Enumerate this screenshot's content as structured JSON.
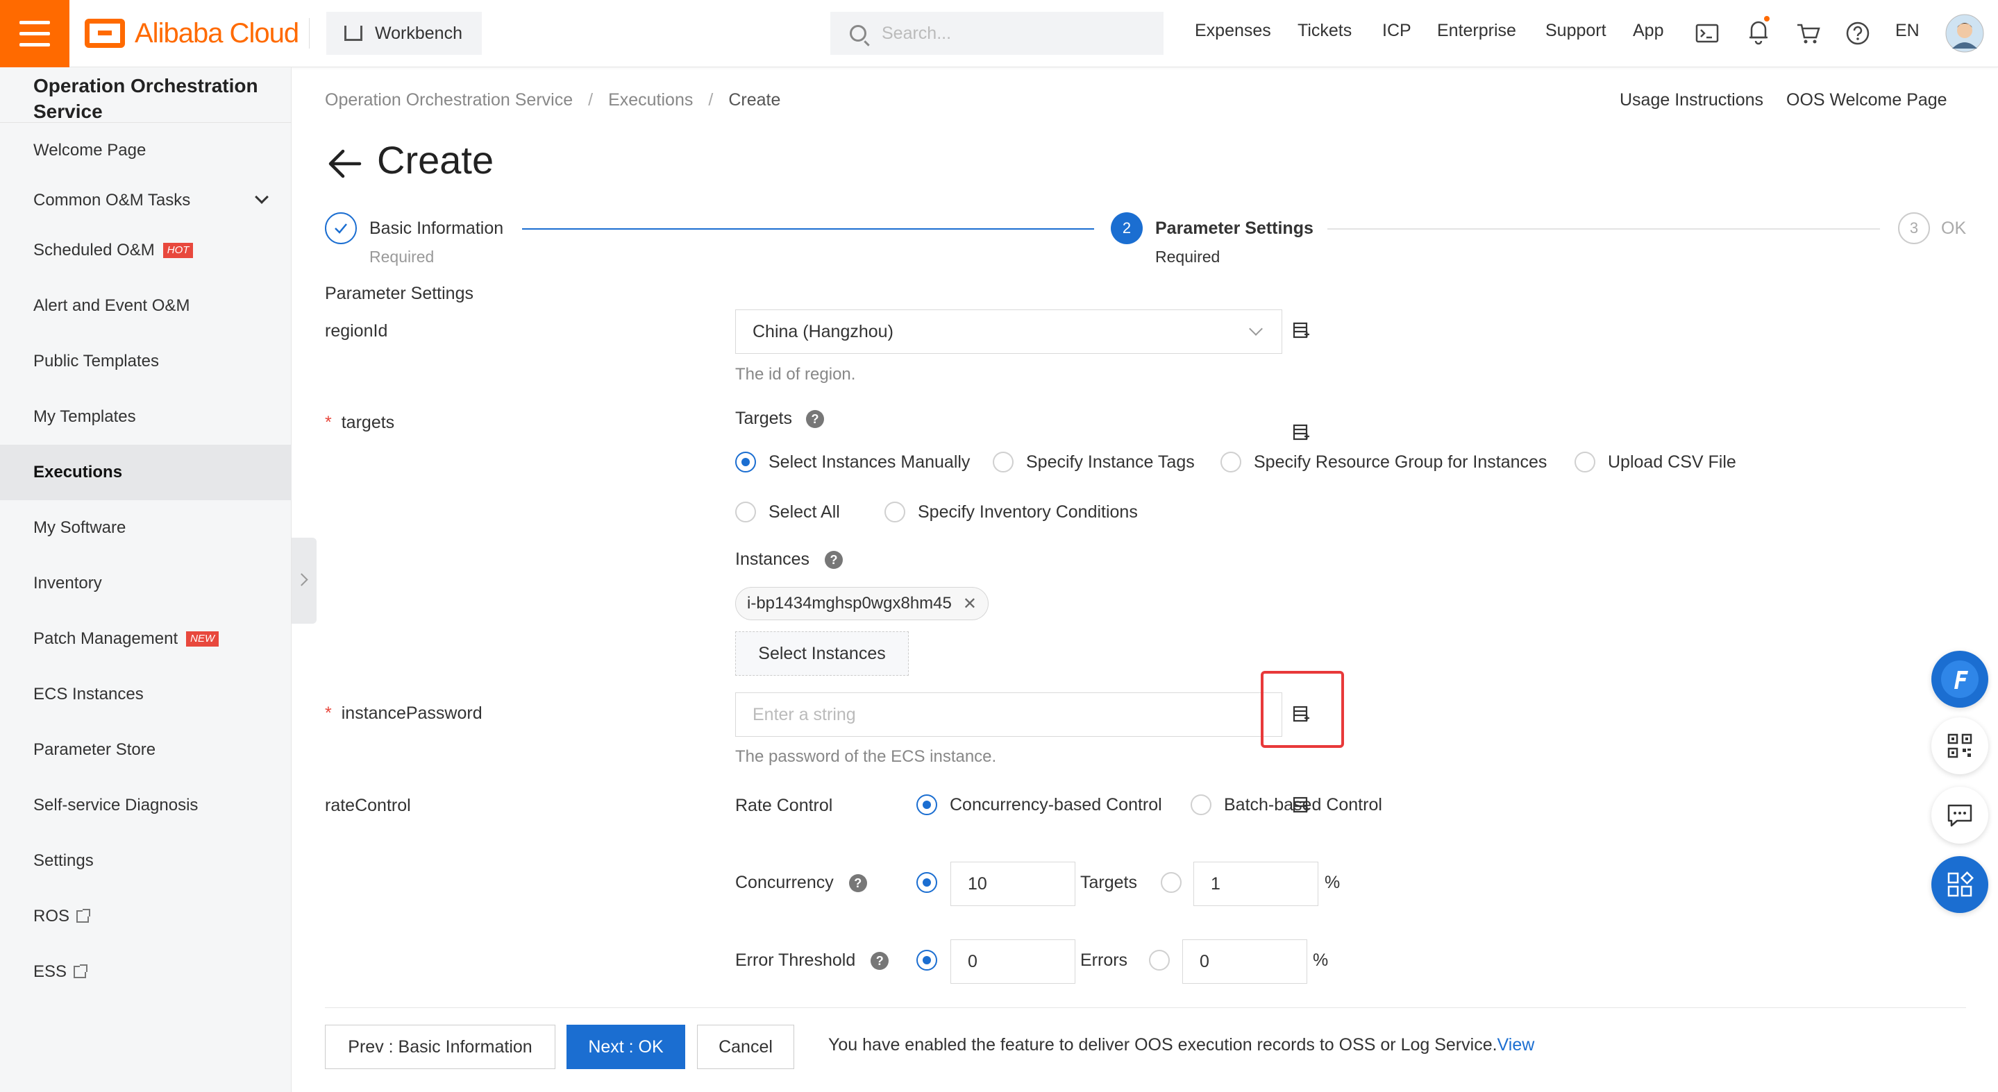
{
  "topbar": {
    "brand": "Alibaba Cloud",
    "workbench": "Workbench",
    "search_placeholder": "Search...",
    "nav": [
      "Expenses",
      "Tickets",
      "ICP",
      "Enterprise",
      "Support",
      "App"
    ],
    "language": "EN"
  },
  "sidebar": {
    "title": "Operation Orchestration Service",
    "items": [
      {
        "label": "Welcome Page"
      },
      {
        "label": "Common O&M Tasks"
      },
      {
        "label": "Scheduled O&M",
        "tag": "HOT"
      },
      {
        "label": "Alert and Event O&M"
      },
      {
        "label": "Public Templates"
      },
      {
        "label": "My Templates"
      },
      {
        "label": "Executions"
      },
      {
        "label": "My Software"
      },
      {
        "label": "Inventory"
      },
      {
        "label": "Patch Management",
        "tag": "NEW"
      },
      {
        "label": "ECS Instances"
      },
      {
        "label": "Parameter Store"
      },
      {
        "label": "Self-service Diagnosis"
      },
      {
        "label": "Settings"
      },
      {
        "label": "ROS"
      },
      {
        "label": "ESS"
      }
    ]
  },
  "breadcrumb": [
    "Operation Orchestration Service",
    "Executions",
    "Create"
  ],
  "header_links": {
    "usage": "Usage Instructions",
    "welcome": "OOS Welcome Page"
  },
  "page_title": "Create",
  "steps": [
    {
      "title": "Basic Information",
      "sub": "Required",
      "status": "done"
    },
    {
      "number": "2",
      "title": "Parameter Settings",
      "sub": "Required",
      "status": "current"
    },
    {
      "number": "3",
      "title": "OK",
      "status": "pending"
    }
  ],
  "form": {
    "section_title": "Parameter Settings",
    "regionId": {
      "label": "regionId",
      "value": "China (Hangzhou)",
      "hint": "The id of region."
    },
    "targets": {
      "label": "targets",
      "sub_label": "Targets",
      "options": [
        "Select Instances Manually",
        "Specify Instance Tags",
        "Specify Resource Group for Instances",
        "Upload CSV File",
        "Select All",
        "Specify Inventory Conditions"
      ],
      "selected": "Select Instances Manually",
      "instances_label": "Instances",
      "instances": [
        "i-bp1434mghsp0wgx8hm45"
      ],
      "select_button": "Select Instances"
    },
    "instancePassword": {
      "label": "instancePassword",
      "placeholder": "Enter a string",
      "value": "",
      "hint": "The password of the ECS instance."
    },
    "rateControl": {
      "label": "rateControl",
      "rate_label": "Rate Control",
      "modes": [
        "Concurrency-based Control",
        "Batch-based Control"
      ],
      "selected_mode": "Concurrency-based Control",
      "concurrency": {
        "label": "Concurrency",
        "value": "10",
        "unit": "Targets",
        "percent_value": "1",
        "percent_sign": "%"
      },
      "error_threshold": {
        "label": "Error Threshold",
        "value": "0",
        "unit": "Errors",
        "percent_value": "0",
        "percent_sign": "%"
      }
    }
  },
  "footer": {
    "prev": "Prev : Basic Information",
    "next": "Next : OK",
    "cancel": "Cancel",
    "notice": "You have enabled the feature to deliver OOS execution records to OSS or Log Service.",
    "notice_link": "View"
  },
  "colors": {
    "brand": "#ff6a00",
    "primary": "#1b6ed1",
    "required": "#e8483d",
    "highlight": "#e8393a"
  }
}
